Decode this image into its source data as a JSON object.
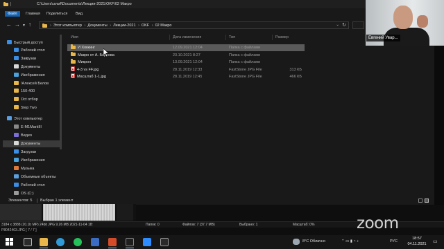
{
  "window": {
    "title_path": "C:\\Users\\uvarf\\Documents\\Лекции-2021\\OKF\\02 Макро"
  },
  "ribbon": {
    "tabs": [
      "Файл",
      "Главная",
      "Поделиться",
      "Вид"
    ]
  },
  "address": {
    "crumbs": [
      "Этот компьютер",
      "Документы",
      "Лекции-2021",
      "OKF",
      "02 Макро"
    ]
  },
  "sidebar": {
    "items": [
      {
        "label": "Быстрый доступ",
        "icon": "star-icon",
        "color": "#3a8ee6",
        "pinned": false
      },
      {
        "label": "Рабочий стол",
        "icon": "desktop-icon",
        "color": "#3a8ee6",
        "pinned": true
      },
      {
        "label": "Загрузки",
        "icon": "download-icon",
        "color": "#3a8ee6",
        "pinned": true
      },
      {
        "label": "Документы",
        "icon": "documents-icon",
        "color": "#d9d9d9",
        "pinned": true
      },
      {
        "label": "Изображения",
        "icon": "pictures-icon",
        "color": "#4aa3df",
        "pinned": true
      },
      {
        "label": "!Алексей Белов",
        "icon": "folder-icon",
        "color": "#e8b64a",
        "pinned": false
      },
      {
        "label": "150-400",
        "icon": "folder-icon",
        "color": "#e8b64a",
        "pinned": false
      },
      {
        "label": "Oct отбор",
        "icon": "folder-icon",
        "color": "#e8b64a",
        "pinned": false
      },
      {
        "label": "Step Two",
        "icon": "folder-icon",
        "color": "#e8b64a",
        "pinned": false
      },
      {
        "label": "Этот компьютер",
        "icon": "computer-icon",
        "color": "#5aa0e0",
        "pinned": false
      },
      {
        "label": "E-M1MarkIII",
        "icon": "camera-icon",
        "color": "#888888",
        "pinned": false
      },
      {
        "label": "Видео",
        "icon": "video-icon",
        "color": "#7a6fd6",
        "pinned": false
      },
      {
        "label": "Документы",
        "icon": "documents-icon",
        "color": "#d9d9d9",
        "pinned": false,
        "selected": true
      },
      {
        "label": "Загрузки",
        "icon": "download-icon",
        "color": "#3a8ee6",
        "pinned": false
      },
      {
        "label": "Изображения",
        "icon": "pictures-icon",
        "color": "#4aa3df",
        "pinned": false
      },
      {
        "label": "Музыка",
        "icon": "music-icon",
        "color": "#e07a3a",
        "pinned": false
      },
      {
        "label": "Объемные объекты",
        "icon": "3d-objects-icon",
        "color": "#5aa0e0",
        "pinned": false
      },
      {
        "label": "Рабочий стол",
        "icon": "desktop-icon",
        "color": "#3a8ee6",
        "pinned": false
      },
      {
        "label": "OS (C:)",
        "icon": "drive-icon",
        "color": "#9a9a9a",
        "pinned": false
      }
    ]
  },
  "columns": {
    "name": "Имя",
    "date": "Дата изменения",
    "type": "Тип",
    "size": "Размер"
  },
  "files": [
    {
      "name": "И Хоккинг",
      "date": "12.09.2021 12:04",
      "type": "Папка с файлами",
      "size": "",
      "kind": "folder",
      "selected": true
    },
    {
      "name": "Макро от А. Барсова",
      "date": "23.10.2021 8:27",
      "type": "Папка с файлами",
      "size": "",
      "kind": "folder"
    },
    {
      "name": "Микрон",
      "date": "13.09.2021 12:04",
      "type": "Папка с файлами",
      "size": "",
      "kind": "folder"
    },
    {
      "name": "4-3 vs FF.jpg",
      "date": "28.11.2019 12:33",
      "type": "FastStone JPG File",
      "size": "313 КБ",
      "kind": "jpg"
    },
    {
      "name": "Масштаб 1-1.jpg",
      "date": "28.11.2019 12:45",
      "type": "FastStone JPG File",
      "size": "466 КБ",
      "kind": "jpg"
    }
  ],
  "status": {
    "count": "Элементов: 5",
    "selected": "Выбран 1 элемент"
  },
  "video": {
    "participant_name": "Евгений Увар..."
  },
  "viewer": {
    "info": "3184 x 3888 (20.1b MP)  24bit  JPG  9.26 MB   2021-11-04 18:",
    "folder_info": "Папок: 0",
    "files_info": "Файлов: 7 (37.7 MB)",
    "selected_info": "Выбрано: 1",
    "zoom_info": "Масштаб: 0%",
    "file_index": "P8042403.JPG [ 7 / 7 ]"
  },
  "zoom_watermark": "zoom",
  "taskbar": {
    "weather": "8°C  Облачно",
    "lang": "РУС",
    "time": "18:57",
    "date": "04.11.2021"
  }
}
